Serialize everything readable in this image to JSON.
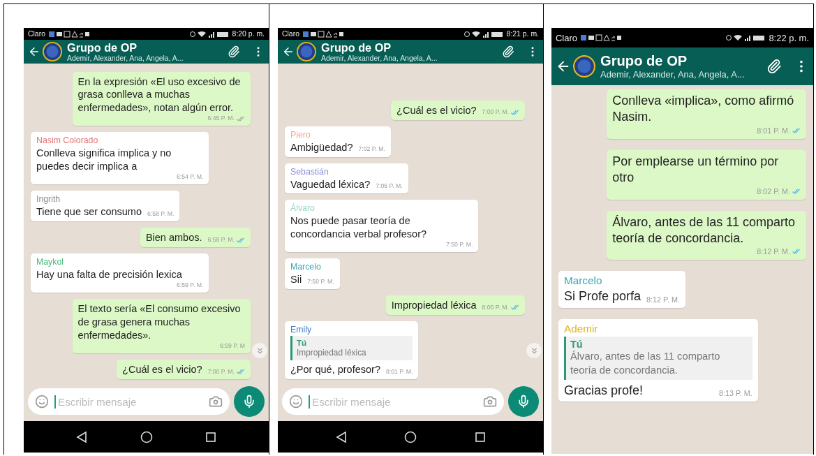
{
  "phones": [
    {
      "status_bar": {
        "carrier": "Claro",
        "time": "8:20 p. m."
      },
      "header": {
        "title": "Grupo de OP",
        "subtitle": "Ademir, Alexander, Ana, Angela, A..."
      },
      "messages": [
        {
          "kind": "out",
          "text": "En la expresión «El uso excesivo de grasa conlleva a  muchas enfermedades», notan algún error.",
          "time": "6:45 P. M.",
          "read": false
        },
        {
          "kind": "in",
          "sender": "Nasim Colorado",
          "color": "#e57373",
          "text": "Conlleva significa implica y no puedes decir implica a",
          "time": "6:54 P. M."
        },
        {
          "kind": "in",
          "sender": "Ingrith",
          "color": "#8a8a8a",
          "text": "Tiene que ser consumo",
          "time": "6:58 P. M."
        },
        {
          "kind": "out",
          "text": "Bien ambos.",
          "time": "6:58 P. M.",
          "read": true
        },
        {
          "kind": "in",
          "sender": "Maykol",
          "color": "#4cb87a",
          "text": "Hay una falta de precisión lexica",
          "time": "6:59 P. M."
        },
        {
          "kind": "out",
          "text": "El texto sería «El consumo excesivo de grasa genera muchas enfermedades».",
          "time": "6:59 P. M"
        },
        {
          "kind": "out",
          "text": "¿Cuál es el vicio?",
          "time": "7:00 P. M.",
          "read": true
        }
      ],
      "scroll_down": true,
      "composer": {
        "placeholder": "Escribir mensaje"
      },
      "nav_bar": true
    },
    {
      "status_bar": {
        "carrier": "Claro",
        "time": "8:21 p. m."
      },
      "header": {
        "title": "Grupo de OP",
        "subtitle": "Ademir, Alexander, Ana, Angela, A..."
      },
      "messages": [
        {
          "kind": "out",
          "text": "¿Cuál es el vicio?",
          "time": "7:00 P. M.",
          "read": true
        },
        {
          "kind": "in",
          "sender": "Piero",
          "color": "#f2a58e",
          "text": "Ambigüedad?",
          "time": "7:02 P. M."
        },
        {
          "kind": "in",
          "sender": "Sebastián",
          "color": "#8c8fd6",
          "text": "Vaguedad léxica?",
          "time": "7:06 P. M."
        },
        {
          "kind": "in",
          "sender": "Álvaro",
          "color": "#9bd6c6",
          "text": "Nos puede pasar teoría de concordancia verbal profesor?",
          "time": "7:50 P. M."
        },
        {
          "kind": "in",
          "sender": "Marcelo",
          "color": "#3aa6b9",
          "text": "Sii",
          "time": "7:50 P. M."
        },
        {
          "kind": "out",
          "text": "Impropiedad léxica",
          "time": "8:00 P. M.",
          "read": true
        },
        {
          "kind": "in",
          "sender": "Emily",
          "color": "#3b7dc4",
          "quote": {
            "author": "Tú",
            "text": "Impropiedad léxica"
          },
          "text": "¿Por qué, profesor?",
          "time": "8:01 P. M."
        }
      ],
      "scroll_down": true,
      "composer": {
        "placeholder": "Escribir mensaje"
      },
      "nav_bar": true
    },
    {
      "status_bar": {
        "carrier": "Claro",
        "time": "8:22 p. m."
      },
      "header": {
        "title": "Grupo de OP",
        "subtitle": "Ademir, Alexander, Ana, Angela, A..."
      },
      "messages": [
        {
          "kind": "out",
          "text": "Conlleva «implica», como afirmó Nasim.",
          "time": "8:01 P. M.",
          "read": true
        },
        {
          "kind": "out",
          "text": "Por emplearse un término por otro",
          "time": "8:02 P. M.",
          "read": true
        },
        {
          "kind": "out",
          "text": "Álvaro, antes de las 11 comparto teoría de concordancia.",
          "time": "8:12 P. M.",
          "read": true
        },
        {
          "kind": "in",
          "sender": "Marcelo",
          "color": "#3aa6b9",
          "text": "Si Profe porfa",
          "time": "8:12 P. M."
        },
        {
          "kind": "in",
          "sender": "Ademir",
          "color": "#e2b21e",
          "quote": {
            "author": "Tú",
            "text": "Álvaro, antes de las 11 comparto teoría de concordancia."
          },
          "text": "Gracias profe!",
          "time": "8:13 P. M."
        }
      ],
      "scroll_down": false,
      "nav_bar": false
    }
  ]
}
